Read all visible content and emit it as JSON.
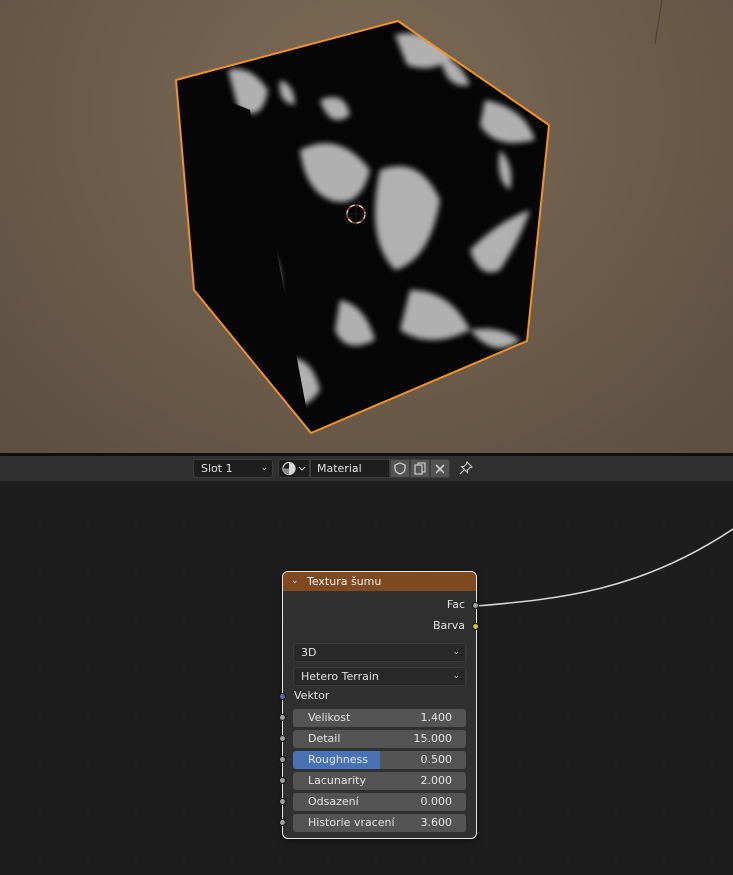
{
  "header": {
    "slot_label": "Slot 1",
    "material_name": "Material",
    "icons": [
      "material-ball-icon",
      "fake-user-shield-icon",
      "duplicate-icon",
      "unlink-x-icon",
      "pin-icon"
    ]
  },
  "node": {
    "title": "Textura šumu",
    "header_color": "#7f4a1f",
    "outputs": [
      {
        "label": "Fac",
        "socket_color": "#a1a1a1"
      },
      {
        "label": "Barva",
        "socket_color": "#c7c729"
      }
    ],
    "dimension": "3D",
    "noise_type": "Hetero Terrain",
    "vector_label": "Vektor",
    "fields": [
      {
        "label": "Velikost",
        "value": "1.400"
      },
      {
        "label": "Detail",
        "value": "15.000"
      },
      {
        "label": "Roughness",
        "value": "0.500",
        "fill_fraction": 0.5
      },
      {
        "label": "Lacunarity",
        "value": "2.000"
      },
      {
        "label": "Odsazení",
        "value": "0.000"
      },
      {
        "label": "Historie vracení",
        "value": "3.600"
      }
    ]
  },
  "colors": {
    "selection_outline": "#f0922a",
    "field_fill": "#4772b3",
    "viewport_background": "#6e5e4c"
  }
}
